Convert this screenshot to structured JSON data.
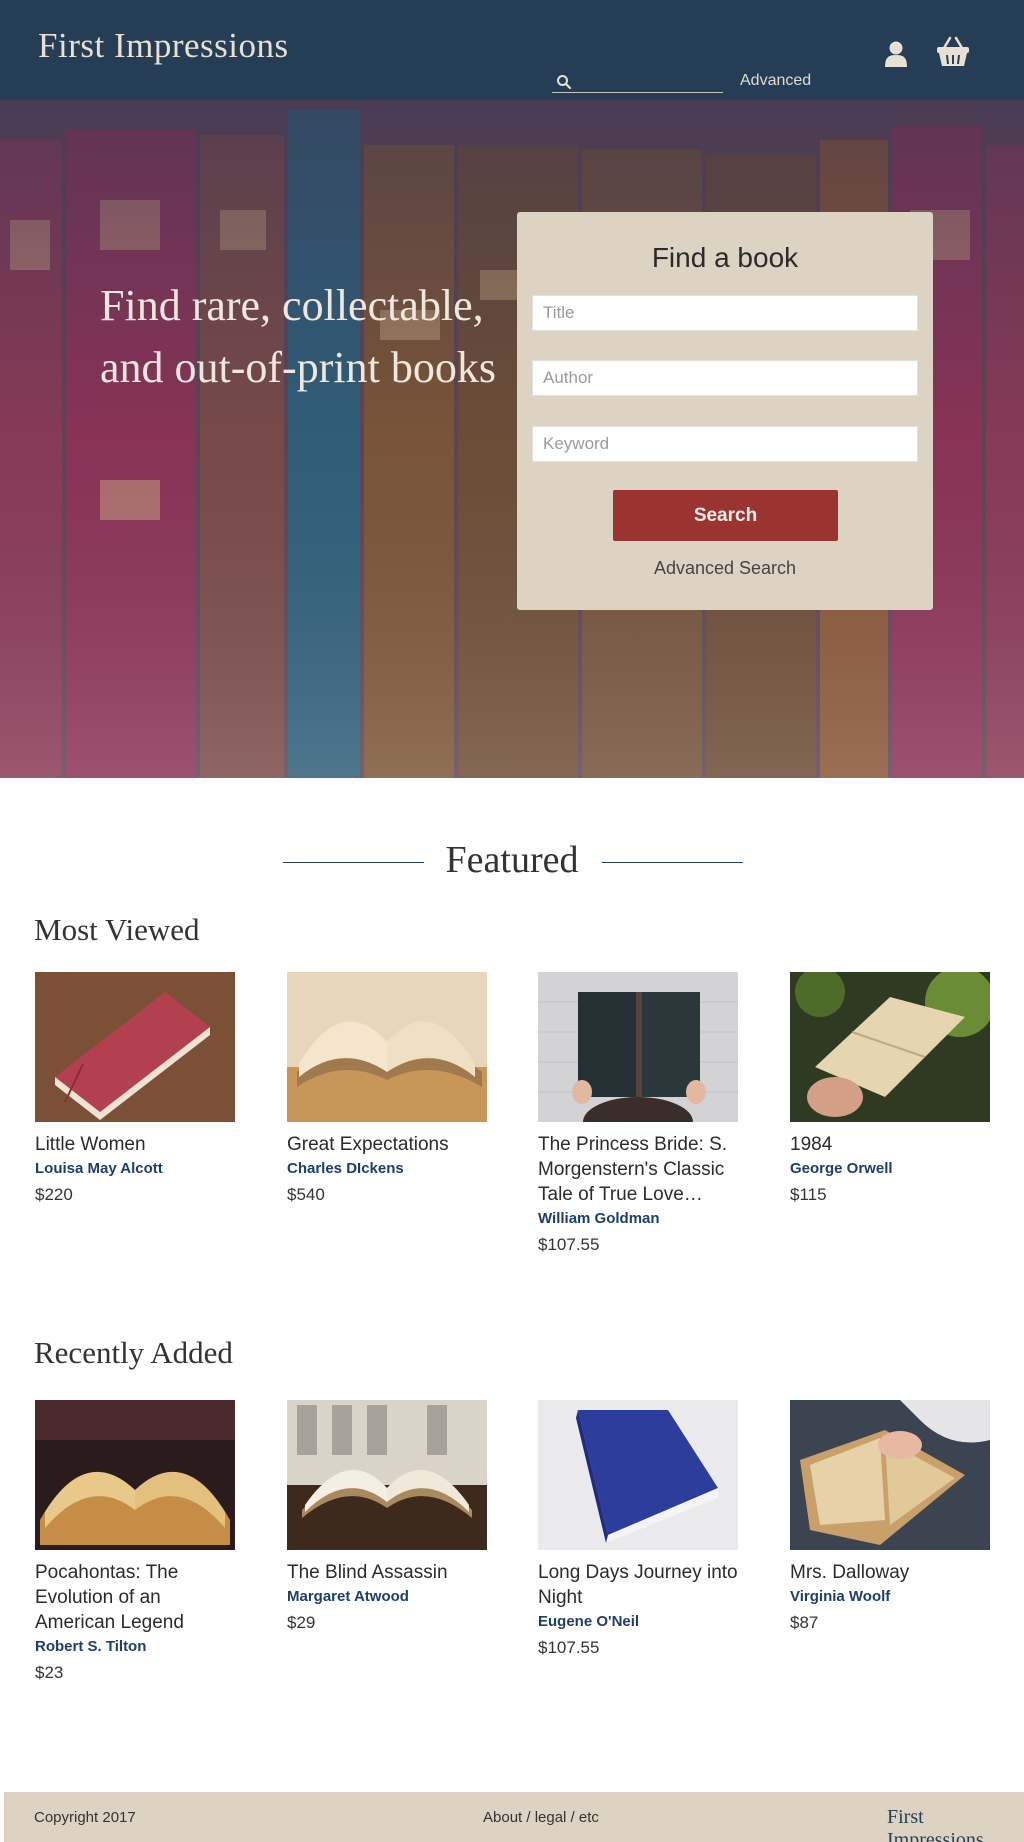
{
  "header": {
    "logo": "First Impressions",
    "search_placeholder": "",
    "advanced_label": "Advanced",
    "icons": [
      "user-icon",
      "cart-icon",
      "search-icon"
    ]
  },
  "hero": {
    "headline": "Find rare, collectable, and out-of-print books",
    "find_box": {
      "title": "Find a book",
      "title_placeholder": "Title",
      "author_placeholder": "Author",
      "keyword_placeholder": "Keyword",
      "search_button": "Search",
      "advanced_link": "Advanced Search"
    }
  },
  "featured": {
    "heading": "Featured",
    "most_viewed": {
      "title": "Most Viewed",
      "items": [
        {
          "title": "Little Women",
          "author": "Louisa May Alcott",
          "price": "$220"
        },
        {
          "title": "Great Expectations",
          "author": "Charles DIckens",
          "price": "$540"
        },
        {
          "title": "The Princess Bride: S. Morgenstern's Classic Tale of True Love…",
          "author": "William Goldman",
          "price": "$107.55"
        },
        {
          "title": "1984",
          "author": "George Orwell",
          "price": "$115"
        }
      ]
    },
    "recently_added": {
      "title": "Recently Added",
      "items": [
        {
          "title": "Pocahontas: The Evolution of an American Legend",
          "author": "Robert S. Tilton",
          "price": "$23"
        },
        {
          "title": "The Blind Assassin",
          "author": "Margaret Atwood",
          "price": "$29"
        },
        {
          "title": "Long Days Journey into Night",
          "author": "Eugene O'Neil",
          "price": "$107.55"
        },
        {
          "title": "Mrs. Dalloway",
          "author": "Virginia Woolf",
          "price": "$87"
        }
      ]
    }
  },
  "footer": {
    "copyright": "Copyright 2017",
    "links": "About / legal / etc",
    "logo": "First Impressions"
  },
  "colors": {
    "header_bg": "#253e55",
    "accent_red": "#9b3431",
    "panel_beige": "#ddd3c3",
    "author_blue": "#1d3f6a"
  }
}
